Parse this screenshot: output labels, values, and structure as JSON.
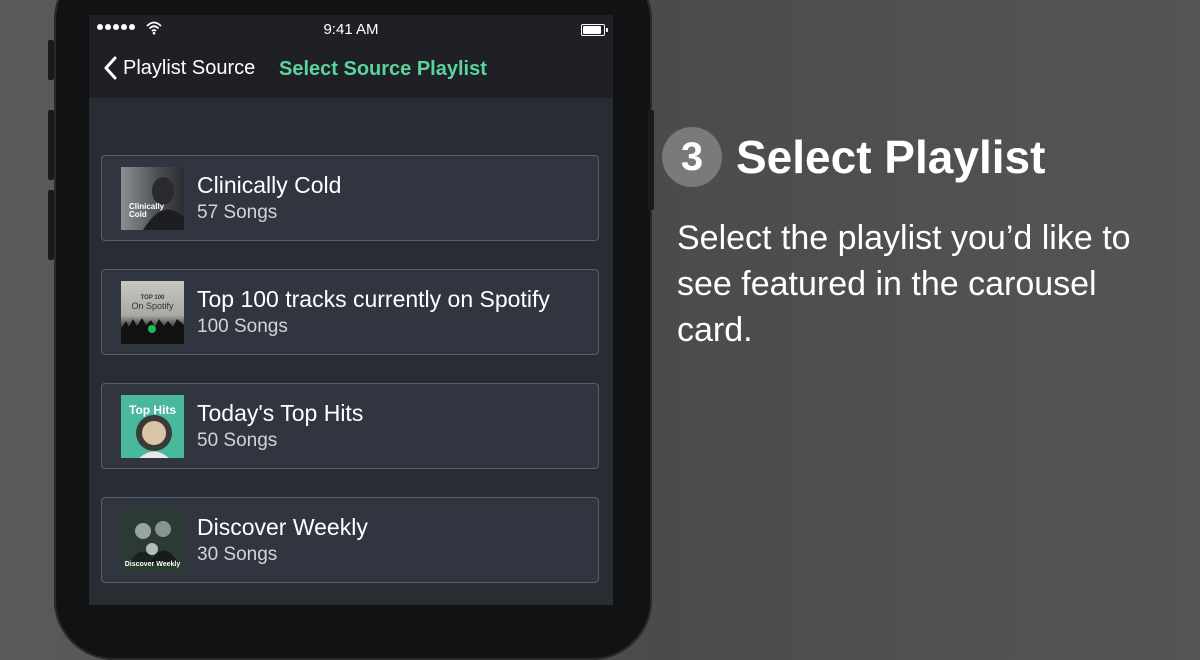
{
  "status_bar": {
    "time": "9:41 AM"
  },
  "nav": {
    "back_label": "Playlist Source",
    "title": "Select Source Playlist"
  },
  "playlists": [
    {
      "title": "Clinically Cold",
      "count": "57 Songs",
      "art_text": "Clinically Cold",
      "art_color": "#6b6e73"
    },
    {
      "title": "Top 100 tracks currently on Spotify",
      "count": "100 Songs",
      "art_text_top": "TOP 100",
      "art_text": "On Spotify",
      "art_color": "#b9b9b3"
    },
    {
      "title": "Today's Top Hits",
      "count": "50 Songs",
      "art_text": "Top Hits",
      "art_color": "#49b89c"
    },
    {
      "title": "Discover Weekly",
      "count": "30 Songs",
      "art_text": "Discover Weekly",
      "art_color": "#2c3a34"
    }
  ],
  "step": {
    "number": "3",
    "title": "Select Playlist",
    "description": "Select the playlist you’d like to see featured in the carousel card."
  },
  "colors": {
    "accent": "#5bd49b",
    "screen_bg": "#292c33",
    "card_bg": "#313540",
    "card_border": "#5a5e66"
  }
}
